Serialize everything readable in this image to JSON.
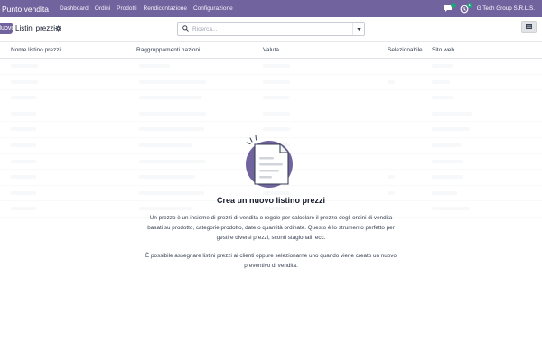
{
  "navbar": {
    "app_name": "Punto vendita",
    "menu": [
      "Dashboard",
      "Ordini",
      "Prodotti",
      "Rendicontazione",
      "Configurazione"
    ],
    "chat_badge": "",
    "activity_badge": "1",
    "company": "G Tech Group S.R.L.S."
  },
  "control": {
    "new_button": "Nuovo",
    "breadcrumb": "Listini prezzi",
    "search_placeholder": "Ricerca..."
  },
  "table": {
    "columns": [
      "Nome listino prezzi",
      "Raggruppamenti nazioni",
      "Valuta",
      "Selezionabile",
      "Sito web"
    ]
  },
  "helper": {
    "title": "Crea un nuovo listino prezzi",
    "paragraph1": "Un prezzo è un insieme di prezzi di vendita o regole per calcolare il prezzo degli ordini di vendita basati su prodotto, categorie prodotto, date o quantità ordinate. Questo è lo strumento perfetto per gestire diversi prezzi, sconti stagionali, ecc.",
    "paragraph2": "È possibile assegnare listini prezzi ai clienti oppure selezionarne uno quando viene creato un nuovo preventivo di vendita."
  },
  "colors": {
    "brand": "#71639e",
    "badge": "#1fa37b"
  },
  "icons": [
    "chat-icon",
    "activity-icon",
    "gear-icon",
    "search-icon",
    "caret-down-icon",
    "list-view-icon",
    "empty-document-icon"
  ]
}
